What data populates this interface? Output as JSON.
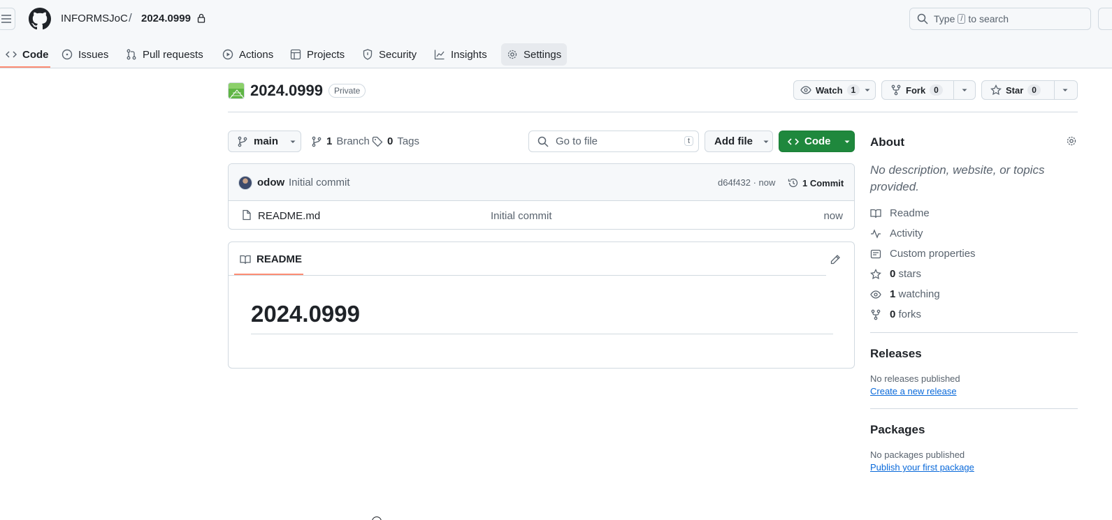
{
  "header": {
    "owner": "INFORMSJoC",
    "separator": "/",
    "repo": "2024.0999",
    "search": {
      "prefix": "Type",
      "key": "/",
      "suffix": "to search"
    }
  },
  "tabs": [
    {
      "label": "Code",
      "icon": "code-icon",
      "selected": true
    },
    {
      "label": "Issues",
      "icon": "issue-opened-icon"
    },
    {
      "label": "Pull requests",
      "icon": "git-pull-request-icon"
    },
    {
      "label": "Actions",
      "icon": "play-icon"
    },
    {
      "label": "Projects",
      "icon": "table-icon"
    },
    {
      "label": "Security",
      "icon": "shield-icon"
    },
    {
      "label": "Insights",
      "icon": "graph-icon"
    },
    {
      "label": "Settings",
      "icon": "gear-icon"
    }
  ],
  "repo": {
    "title": "2024.0999",
    "visibility": "Private",
    "watch": {
      "label": "Watch",
      "count": "1"
    },
    "fork": {
      "label": "Fork",
      "count": "0"
    },
    "star": {
      "label": "Star",
      "count": "0"
    }
  },
  "file_nav": {
    "branch": "main",
    "branches_count": "1",
    "branches_label": "Branch",
    "tags_count": "0",
    "tags_label": "Tags",
    "goto_placeholder": "Go to file",
    "goto_key": "t",
    "add_file": "Add file",
    "code": "Code"
  },
  "commit": {
    "author": "odow",
    "message": "Initial commit",
    "sha_time": "d64f432 · now",
    "count_label": "1 Commit"
  },
  "files": [
    {
      "name": "README.md",
      "commit": "Initial commit",
      "time": "now"
    }
  ],
  "readme": {
    "tab_label": "README",
    "heading": "2024.0999"
  },
  "about": {
    "title": "About",
    "description": "No description, website, or topics provided.",
    "items": [
      {
        "icon": "book-icon",
        "count": "",
        "label": "Readme"
      },
      {
        "icon": "pulse-icon",
        "count": "",
        "label": "Activity"
      },
      {
        "icon": "note-icon",
        "count": "",
        "label": "Custom properties"
      },
      {
        "icon": "star-icon",
        "count": "0",
        "label": "stars"
      },
      {
        "icon": "eye-icon",
        "count": "1",
        "label": "watching"
      },
      {
        "icon": "repo-forked-icon",
        "count": "0",
        "label": "forks"
      }
    ]
  },
  "releases": {
    "title": "Releases",
    "empty": "No releases published",
    "link": "Create a new release"
  },
  "packages": {
    "title": "Packages",
    "empty": "No packages published",
    "link": "Publish your first package"
  },
  "colors": {
    "accent_underline": "#fd8c73",
    "primary_button": "#1f883d",
    "link": "#0969da"
  }
}
